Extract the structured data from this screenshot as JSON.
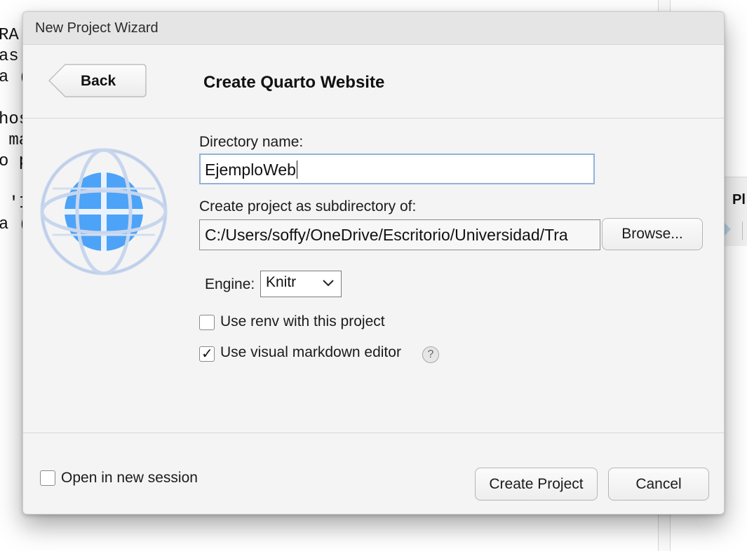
{
  "background": {
    "editor_lines": [
      "RA",
      "as",
      "a (",
      "",
      "hos",
      " ma",
      "o p",
      "",
      " 'I",
      "a ("
    ],
    "right_panel_label": "Pl"
  },
  "dialog": {
    "title": "New Project Wizard",
    "back_label": "Back",
    "heading": "Create Quarto Website",
    "directory_label": "Directory name:",
    "directory_value": "EjemploWeb",
    "subdir_label": "Create project as subdirectory of:",
    "subdir_value": "C:/Users/soffy/OneDrive/Escritorio/Universidad/Tra",
    "browse_label": "Browse...",
    "engine_label": "Engine:",
    "engine_value": "Knitr",
    "renv_label": "Use renv with this project",
    "renv_checked": false,
    "visual_label": "Use visual markdown editor",
    "visual_checked": true,
    "help_glyph": "?",
    "new_session_label": "Open in new session",
    "new_session_checked": false,
    "create_label": "Create Project",
    "cancel_label": "Cancel",
    "check_glyph": "✓",
    "icon": "quarto-globe-icon",
    "colors": {
      "globe_fill": "#4da3f7",
      "globe_ring": "#c7d6ee",
      "input_focus_border": "#8fb3d9"
    }
  }
}
